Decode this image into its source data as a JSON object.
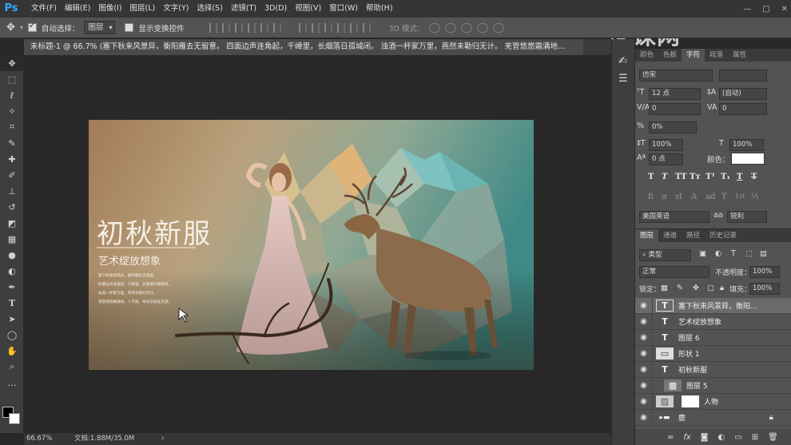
{
  "app": {
    "logo": "Ps"
  },
  "menu": [
    "文件(F)",
    "编辑(E)",
    "图像(I)",
    "图层(L)",
    "文字(Y)",
    "选择(S)",
    "滤镜(T)",
    "3D(D)",
    "视图(V)",
    "窗口(W)",
    "帮助(H)"
  ],
  "window_controls": [
    "—",
    "□",
    "✕"
  ],
  "options": {
    "auto_select_label": "自动选择：",
    "auto_select_value": "图层",
    "show_transform_label": "显示变换控件",
    "mode_label": "3D 模式："
  },
  "document_tab": {
    "title": "未标题-1 @ 66.7% (塞下秋来风景异，衡阳雁去无留意。 四面边声连角起，千嶂里，长烟落日孤城闭。 浊酒一杯家万里，燕然未勒归无计。 羌管悠悠霜满地..."
  },
  "watermark": "虎课网",
  "artwork": {
    "title": "初秋新服",
    "subtitle": "艺术绽放想象",
    "poem_lines": [
      "塞下秋来风景异，衡阳雁去无留意。",
      "四面边声连角起，千嶂里，长烟落日孤城闭。",
      "浊酒一杯家万里，燕然未勒归无计。",
      "羌管悠悠霜满地，人不寐，将军白发征夫泪。"
    ]
  },
  "character_panel": {
    "tabs": [
      "颜色",
      "色板",
      "字符",
      "段落",
      "属性"
    ],
    "active_tab": "字符",
    "font_family": "仿宋",
    "font_size": "12 点",
    "leading": "(自动)",
    "kerning": "0",
    "tracking": "0",
    "scale_percent": "0%",
    "vertical_scale": "100%",
    "horizontal_scale": "100%",
    "baseline_shift": "0 点",
    "color_label": "颜色：",
    "text_color": "#ffffff",
    "type_buttons": [
      "T",
      "T",
      "TT",
      "Tт",
      "T¹",
      "T₁",
      "T",
      "T"
    ],
    "opentype_buttons": [
      "fi",
      "ơ",
      "st",
      "A",
      "ad",
      "T",
      "1st",
      "½"
    ],
    "language": "美国英语",
    "antialias_label": "aa",
    "antialias": "锐利"
  },
  "layers_panel": {
    "tabs": [
      "图层",
      "通道",
      "路径",
      "历史记录"
    ],
    "active_tab": "图层",
    "filter_kind": "类型",
    "blend_mode": "正常",
    "opacity_label": "不透明度：",
    "opacity": "100%",
    "lock_label": "锁定：",
    "fill_label": "填充：",
    "fill": "100%",
    "layers": [
      {
        "name": "塞下秋来风景异，衡阳...",
        "thumb": "T",
        "selected": true
      },
      {
        "name": "艺术绽放想象",
        "thumb": "T",
        "selected": false
      },
      {
        "name": "图层 6",
        "thumb": "T",
        "selected": false
      },
      {
        "name": "形状 1",
        "thumb": "▭",
        "selected": false
      },
      {
        "name": "初秋新服",
        "thumb": "T",
        "selected": false
      },
      {
        "name": "图层 5",
        "thumb": "▩",
        "selected": false
      },
      {
        "name": "人物",
        "thumb": "▨",
        "selected": false
      },
      {
        "name": "鹿",
        "thumb": "▸▬",
        "selected": false
      }
    ],
    "bottom_icons": [
      "link-icon",
      "fx-icon",
      "mask-icon",
      "adjustment-icon",
      "group-icon",
      "new-layer-icon",
      "trash-icon"
    ]
  },
  "status": {
    "zoom": "66.67%",
    "doc_info": "文档:1.88M/35.0M"
  }
}
